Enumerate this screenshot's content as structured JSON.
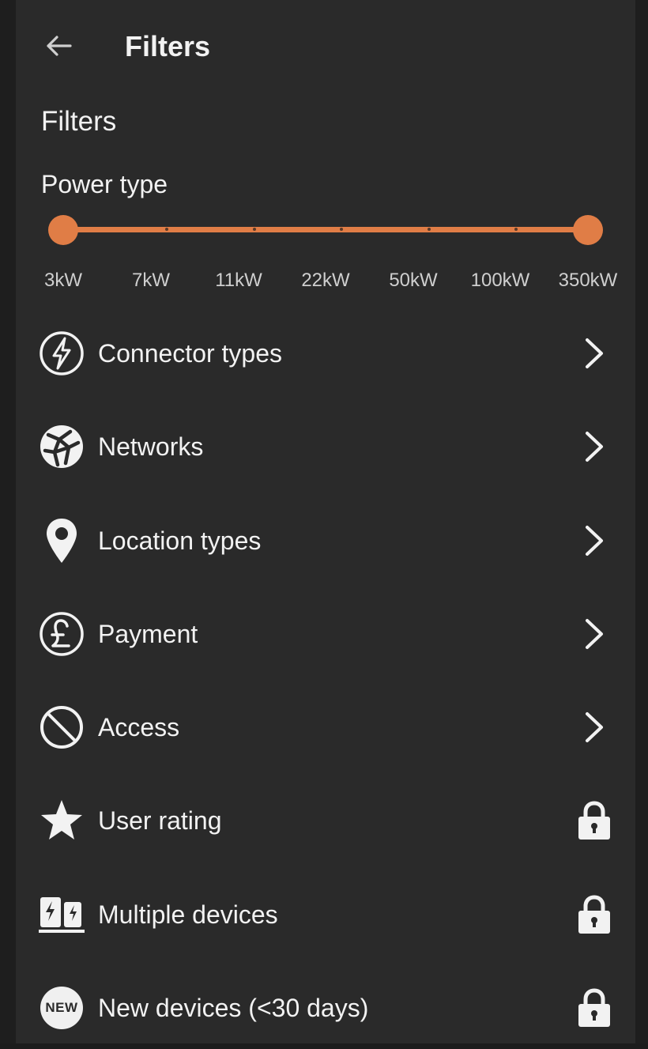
{
  "appbar": {
    "title": "Filters"
  },
  "section": {
    "title": "Filters"
  },
  "power": {
    "label": "Power type",
    "min_index": 0,
    "max_index": 6,
    "options": [
      "3kW",
      "7kW",
      "11kW",
      "22kW",
      "50kW",
      "100kW",
      "350kW"
    ],
    "accent_color": "#e07d46"
  },
  "rows": [
    {
      "label": "Connector types",
      "icon": "bolt-circle-icon",
      "trailing": "chevron-right-icon"
    },
    {
      "label": "Networks",
      "icon": "network-globe-icon",
      "trailing": "chevron-right-icon"
    },
    {
      "label": "Location types",
      "icon": "location-pin-icon",
      "trailing": "chevron-right-icon"
    },
    {
      "label": "Payment",
      "icon": "pound-circle-icon",
      "trailing": "chevron-right-icon"
    },
    {
      "label": "Access",
      "icon": "no-access-icon",
      "trailing": "chevron-right-icon"
    },
    {
      "label": "User rating",
      "icon": "star-icon",
      "trailing": "lock-icon"
    },
    {
      "label": "Multiple devices",
      "icon": "multiple-chargers-icon",
      "trailing": "lock-icon"
    },
    {
      "label": "New devices (<30 days)",
      "icon": "new-badge-icon",
      "badge_text": "NEW",
      "trailing": "lock-icon"
    }
  ]
}
